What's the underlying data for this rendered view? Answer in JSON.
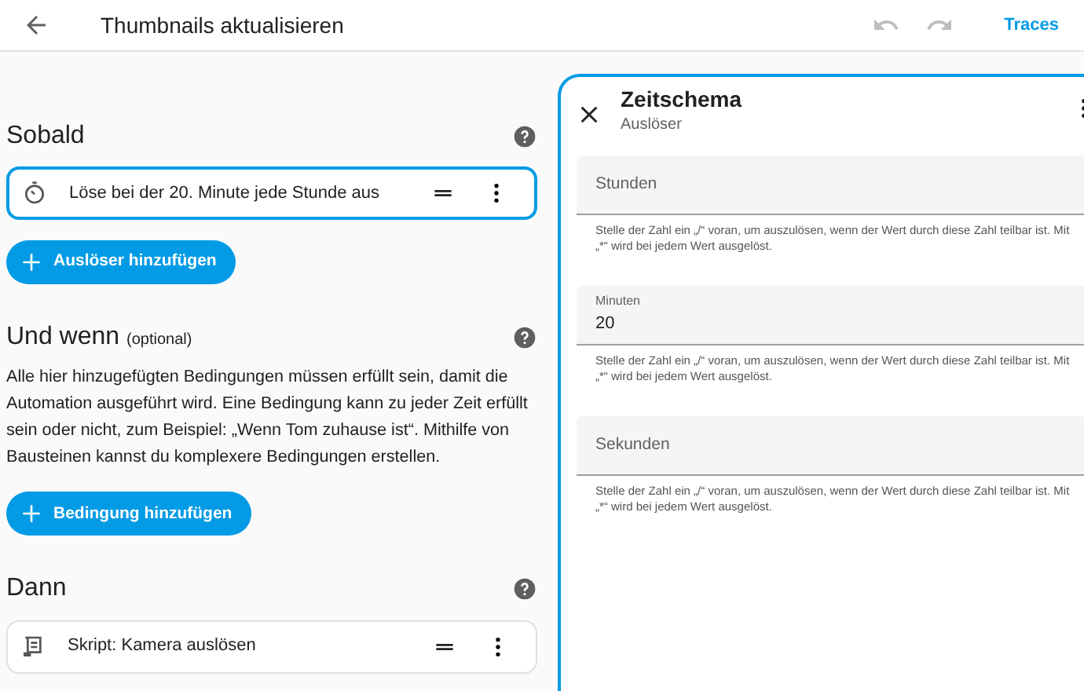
{
  "header": {
    "title": "Thumbnails aktualisieren",
    "undo_disabled": true,
    "redo_disabled": true,
    "link": "Traces"
  },
  "sections": [
    {
      "title": "Sobald",
      "items": [
        {
          "kind": "timer",
          "label": "Löse bei der 20. Minute jede Stunde aus",
          "selected": true
        }
      ],
      "button": "Auslöser hinzufügen"
    },
    {
      "title": "Und wenn",
      "optional": "(optional)",
      "description": "Alle hier hinzugefügten Bedingungen müssen erfüllt sein, damit die Automation ausgeführt wird. Eine Bedingung kann zu jeder Zeit erfüllt sein oder nicht, zum Beispiel: „Wenn Tom zuhause ist“. Mithilfe von Bausteinen kannst du komplexere Bedingungen erstellen.",
      "button": "Bedingung hinzufügen"
    },
    {
      "title": "Dann",
      "items": [
        {
          "kind": "script",
          "label": "Skript: Kamera auslösen",
          "selected": false
        }
      ]
    }
  ],
  "panel": {
    "title": "Zeitschema",
    "subtitle": "Auslöser",
    "fields": [
      {
        "label": "Stunden",
        "helper": "Stelle der Zahl ein „/“ voran, um auszulösen, wenn der Wert durch diese Zahl teilbar ist. Mit „*“ wird bei jedem Wert ausgelöst."
      },
      {
        "label": "Minuten",
        "value": "20",
        "helper": "Stelle der Zahl ein „/“ voran, um auszulösen, wenn der Wert durch diese Zahl teilbar ist. Mit „*“ wird bei jedem Wert ausgelöst."
      },
      {
        "label": "Sekunden",
        "helper": "Stelle der Zahl ein „/“ voran, um auszulösen, wenn der Wert durch diese Zahl teilbar ist. Mit „*“ wird bei jedem Wert ausgelöst."
      }
    ]
  }
}
